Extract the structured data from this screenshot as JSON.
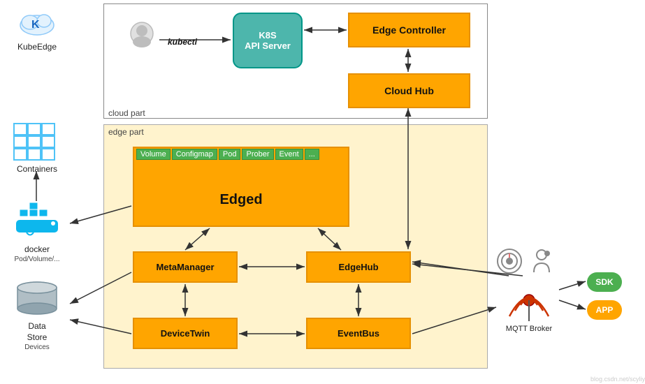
{
  "kubeedge": {
    "label": "KubeEdge"
  },
  "cloud": {
    "part_label": "cloud part",
    "edge_controller": "Edge Controller",
    "cloud_hub": "Cloud Hub",
    "k8s_api_server_line1": "K8S",
    "k8s_api_server_line2": "API Server"
  },
  "edge": {
    "part_label": "edge part",
    "edged_label": "Edged",
    "tags": [
      "Volume",
      "Configmap",
      "Pod",
      "Prober",
      "Event",
      "..."
    ],
    "meta_manager": "MetaManager",
    "edge_hub": "EdgeHub",
    "device_twin": "DeviceTwin",
    "event_bus": "EventBus",
    "kubectl_label": "kubectl"
  },
  "external": {
    "containers": "Containers",
    "docker": "docker",
    "pod_volume": "Pod/Volume/...",
    "datastore": "Data\nStore",
    "datastore_label1": "Data",
    "datastore_label2": "Store",
    "devices": "Devices",
    "mqtt_broker": "MQTT Broker",
    "sdk": "SDK",
    "app": "APP"
  }
}
